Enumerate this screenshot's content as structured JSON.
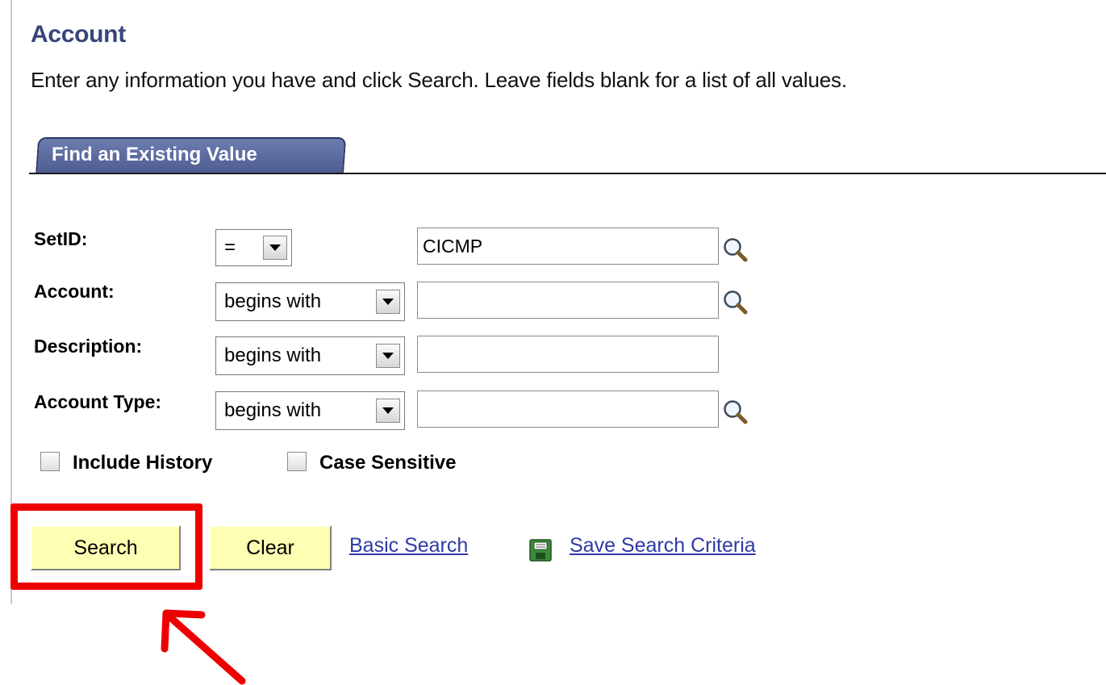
{
  "page": {
    "title": "Account",
    "instructions": "Enter any information you have and click Search. Leave fields blank for a list of all values."
  },
  "tab": {
    "label": "Find an Existing Value"
  },
  "fields": [
    {
      "label": "SetID:",
      "operator": "=",
      "value": "CICMP",
      "lookup_icon": "magnifier-icon"
    },
    {
      "label": "Account:",
      "operator": "begins with",
      "value": "",
      "lookup_icon": "magnifier-icon"
    },
    {
      "label": "Description:",
      "operator": "begins with",
      "value": ""
    },
    {
      "label": "Account Type:",
      "operator": "begins with",
      "value": "",
      "lookup_icon": "magnifier-icon"
    }
  ],
  "options": {
    "include_history": {
      "label": "Include History",
      "checked": false
    },
    "case_sensitive": {
      "label": "Case Sensitive",
      "checked": false
    }
  },
  "actions": {
    "search_label": "Search",
    "clear_label": "Clear",
    "basic_search_link": "Basic Search",
    "save_criteria_icon": "save-icon",
    "save_criteria_link": "Save Search Criteria"
  },
  "colors": {
    "title": "#36457a",
    "tab": "#4d5b8f",
    "button": "#ffffb3",
    "link": "#2e3aa6",
    "annotation": "#ee0000"
  }
}
